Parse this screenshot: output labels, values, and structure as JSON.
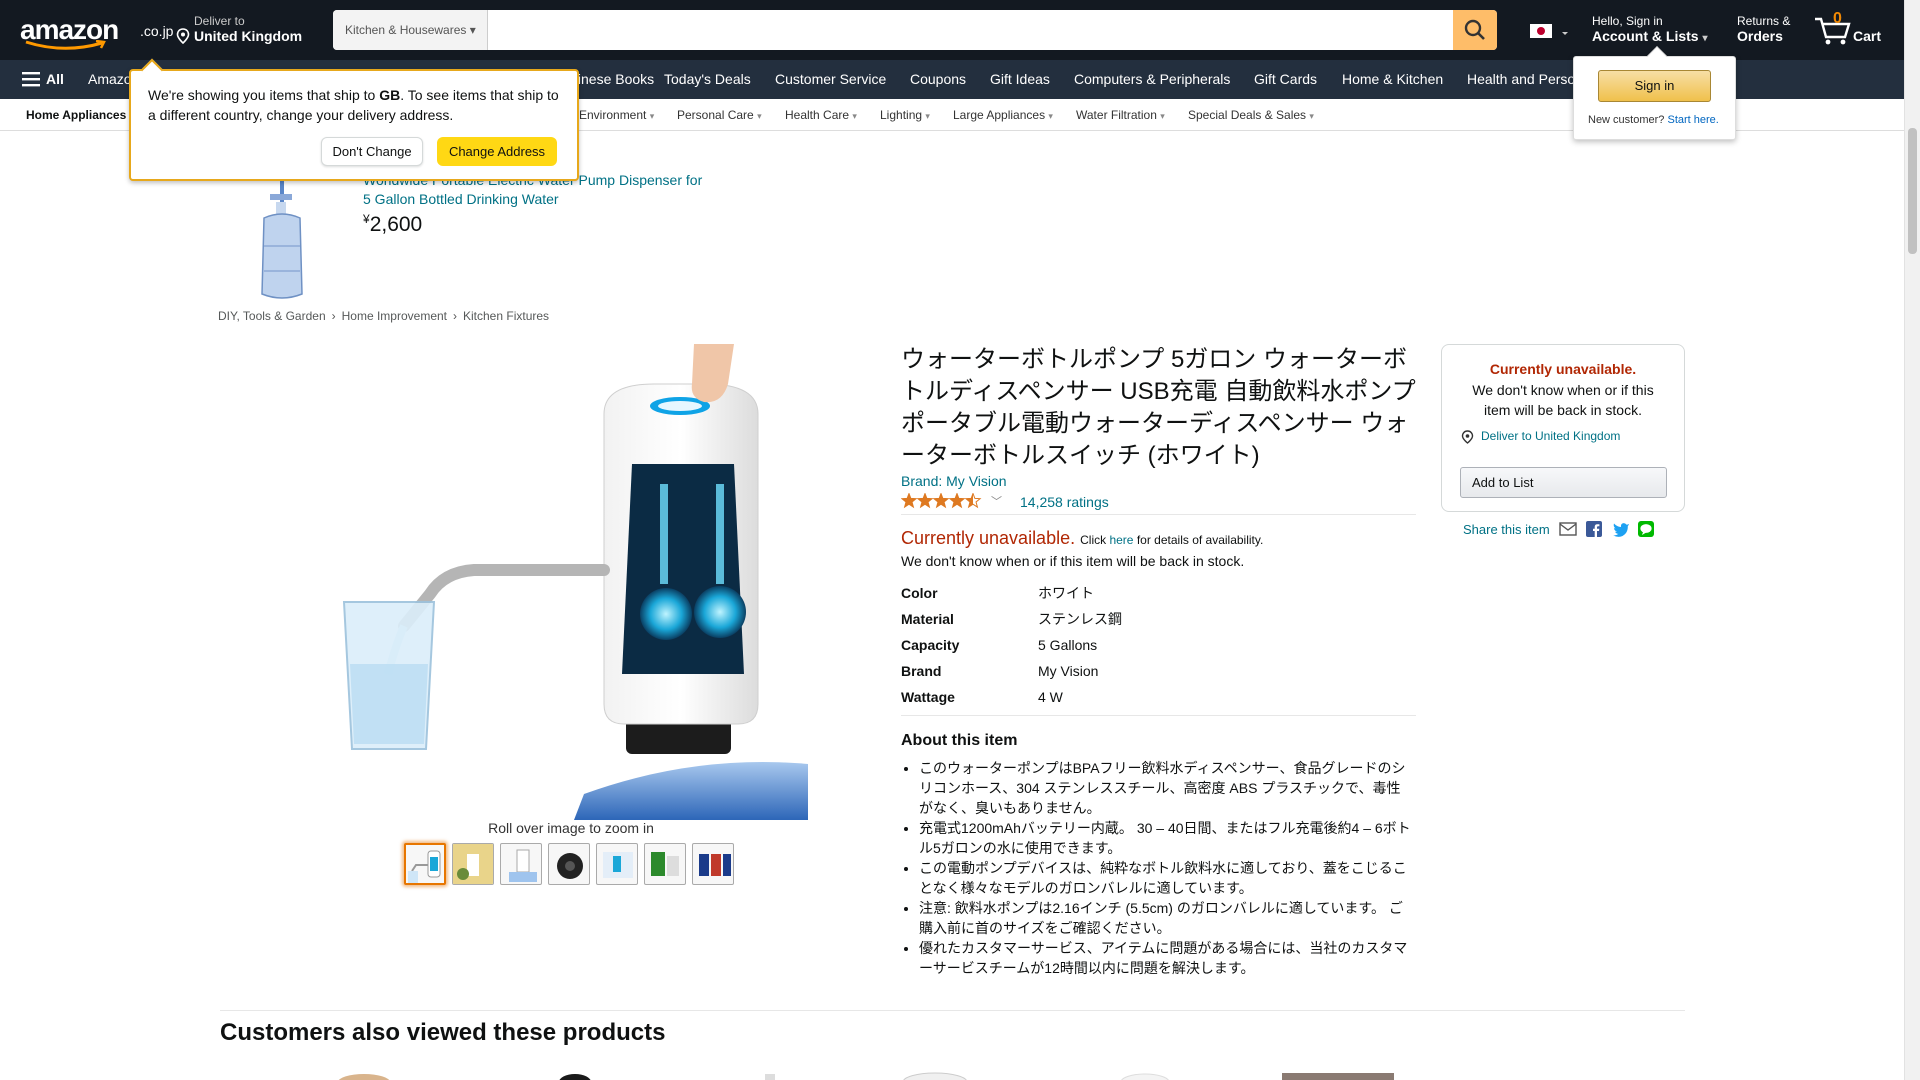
{
  "header": {
    "logo_word": "amazon",
    "logo_tld": ".co.jp",
    "deliver_line1": "Deliver to",
    "deliver_line2": "United Kingdom",
    "search_category": "Kitchen & Housewares",
    "search_placeholder": "",
    "account_line1": "Hello, Sign in",
    "account_line2": "Account & Lists",
    "returns_line1": "Returns &",
    "returns_line2": "Orders",
    "cart_count": "0",
    "cart_label": "Cart"
  },
  "nav": {
    "all_label": "All",
    "items": [
      "Amazon",
      "Chinese Books",
      "Today's Deals",
      "Customer Service",
      "Coupons",
      "Gift Ideas",
      "Computers & Peripherals",
      "Gift Cards",
      "Home & Kitchen",
      "Health and Personal Care"
    ]
  },
  "subnav": {
    "first": "Home Appliances",
    "items": [
      "Environment",
      "Personal Care",
      "Health Care",
      "Lighting",
      "Large Appliances",
      "Water Filtration",
      "Special Deals & Sales"
    ]
  },
  "location_popover": {
    "msg_before": "We're showing you items that ship to ",
    "country": "GB",
    "msg_after": ". To see items that ship to a different country, change your delivery address.",
    "dont_change": "Don't Change",
    "change_address": "Change Address"
  },
  "signin_popover": {
    "button": "Sign in",
    "new_customer": "New customer?",
    "start_here": "Start here."
  },
  "promo": {
    "title": "Worldwide Portable Electric Water Pump Dispenser for 5 Gallon Bottled Drinking Water",
    "currency": "¥",
    "price": "2,600"
  },
  "breadcrumbs": [
    "DIY, Tools & Garden",
    "Home Improvement",
    "Kitchen Fixtures"
  ],
  "product": {
    "title": "ウォーターボトルポンプ 5ガロン ウォーターボトルディスペンサー USB充電 自動飲料水ポンプ ポータブル電動ウォーターディスペンサー ウォーターボトルスイッチ (ホワイト)",
    "brand": "Brand: My Vision",
    "rating_stars": 4.5,
    "ratings_count": "14,258 ratings",
    "zoom_hint": "Roll over image to zoom in",
    "unavailable": "Currently unavailable.",
    "click_prefix": "Click",
    "here": "here",
    "click_suffix": "for details of availability.",
    "unavailable_note": "We don't know when or if this item will be back in stock.",
    "specs": [
      {
        "k": "Color",
        "v": "ホワイト"
      },
      {
        "k": "Material",
        "v": "ステンレス鋼"
      },
      {
        "k": "Capacity",
        "v": "5 Gallons"
      },
      {
        "k": "Brand",
        "v": "My Vision"
      },
      {
        "k": "Wattage",
        "v": "4 W"
      }
    ],
    "about_heading": "About this item",
    "about": [
      "このウォーターポンプはBPAフリー飲料水ディスペンサー、食品グレードのシリコンホース、304 ステンレススチール、高密度 ABS プラスチックで、毒性がなく、臭いもありません。",
      "充電式1200mAhバッテリー内蔵。 30 – 40日間、またはフル充電後約4 – 6ボトル5ガロンの水に使用できます。",
      "この電動ポンプデバイスは、純粋なボトル飲料水に適しており、蓋をこじることなく様々なモデルのガロンバレルに適しています。",
      "注意: 飲料水ポンプは2.16インチ (5.5cm) のガロンバレルに適しています。 ご購入前に首のサイズをご確認ください。",
      "優れたカスタマーサービス、アイテムに問題がある場合には、当社のカスタマーサービスチームが12時間以内に問題を解決します。"
    ]
  },
  "buybox": {
    "unavailable": "Currently unavailable.",
    "note": "We don't know when or if this item will be back in stock.",
    "deliver": "Deliver to United Kingdom",
    "add_to_list": "Add to List"
  },
  "share": {
    "label": "Share this item"
  },
  "also_viewed": {
    "heading": "Customers also viewed these products"
  },
  "colors": {
    "brand_dark": "#131921",
    "nav": "#232f3e",
    "accent": "#febd69",
    "link": "#007185",
    "price_red": "#b12704",
    "button_yellow": "#ffd814"
  }
}
